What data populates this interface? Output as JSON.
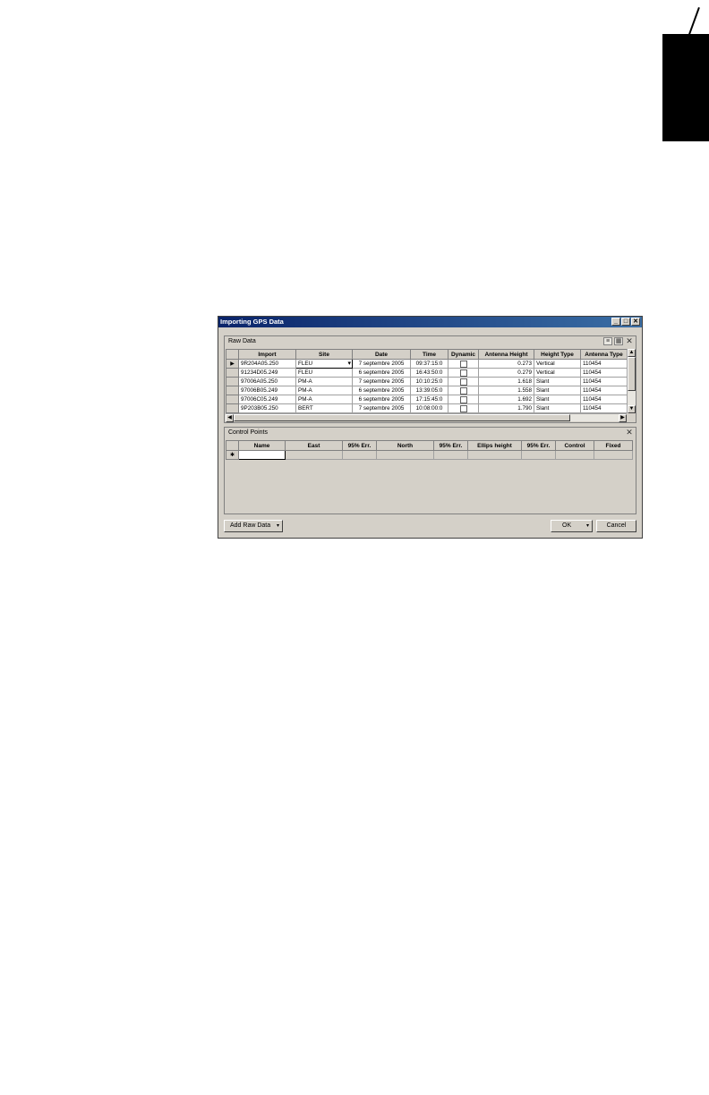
{
  "window": {
    "title": "Importing GPS Data"
  },
  "raw_data": {
    "label": "Raw Data",
    "columns": [
      "Import",
      "Site",
      "Date",
      "Time",
      "Dynamic",
      "Antenna Height",
      "Height Type",
      "Antenna Type"
    ],
    "rows": [
      {
        "import": "9R204A05.250",
        "site": "FLEU",
        "date": "7 septembre 2005",
        "time": "09:37:15:0",
        "height": "0.273",
        "height_type": "Vertical",
        "antenna_type": "110454"
      },
      {
        "import": "91234D05.249",
        "site": "FLEU",
        "date": "6 septembre 2005",
        "time": "16:43:50:0",
        "height": "0.279",
        "height_type": "Vertical",
        "antenna_type": "110454"
      },
      {
        "import": "97006A05.250",
        "site": "PM-A",
        "date": "7 septembre 2005",
        "time": "10:10:25:0",
        "height": "1.618",
        "height_type": "Slant",
        "antenna_type": "110454"
      },
      {
        "import": "97006B05.249",
        "site": "PM-A",
        "date": "6 septembre 2005",
        "time": "13:39:05:0",
        "height": "1.558",
        "height_type": "Slant",
        "antenna_type": "110454"
      },
      {
        "import": "97006C05.249",
        "site": "PM-A",
        "date": "6 septembre 2005",
        "time": "17:15:45:0",
        "height": "1.692",
        "height_type": "Slant",
        "antenna_type": "110454"
      },
      {
        "import": "9P203B05.250",
        "site": "BERT",
        "date": "7 septembre 2005",
        "time": "10:08:00:0",
        "height": "1.790",
        "height_type": "Slant",
        "antenna_type": "110454"
      }
    ]
  },
  "control_points": {
    "label": "Control Points",
    "columns": [
      "Name",
      "East",
      "95% Err.",
      "North",
      "95% Err.",
      "Ellips height",
      "95% Err.",
      "Control",
      "Fixed"
    ],
    "new_row_marker": "✱"
  },
  "buttons": {
    "add_raw_data": "Add Raw Data",
    "ok": "OK",
    "cancel": "Cancel"
  },
  "icons": {
    "current_row": "▶",
    "dropdown": "▾",
    "close": "✕",
    "minimize": "_",
    "maximize": "□"
  }
}
